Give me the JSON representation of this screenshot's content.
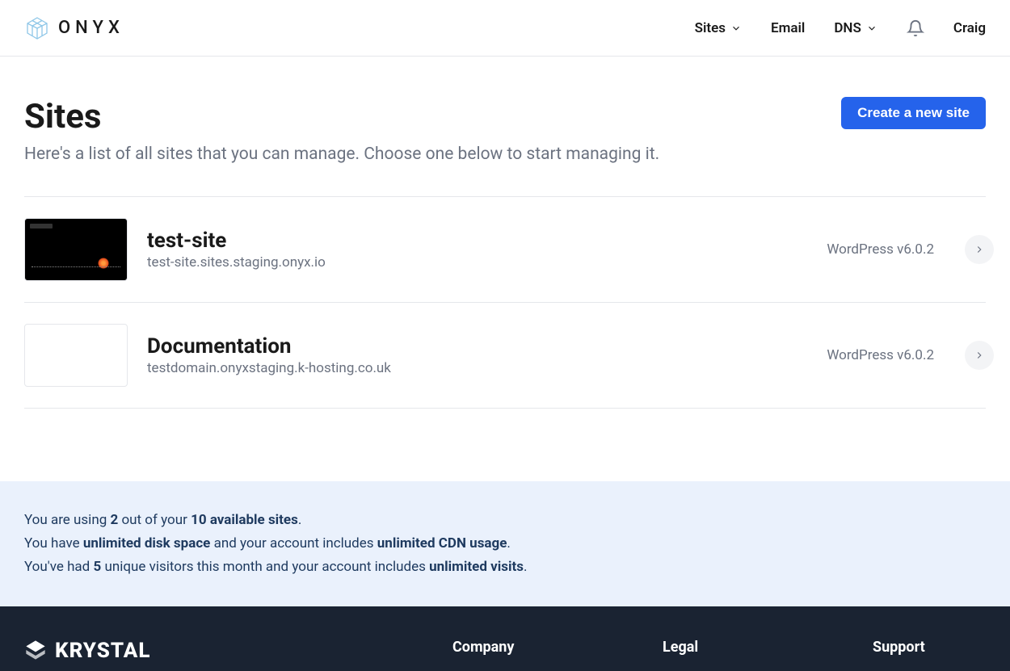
{
  "header": {
    "brand": "ONYX",
    "nav": {
      "sites": "Sites",
      "email": "Email",
      "dns": "DNS",
      "user": "Craig"
    }
  },
  "page": {
    "title": "Sites",
    "subtitle": "Here's a list of all sites that you can manage. Choose one below to start managing it.",
    "create_button": "Create a new site"
  },
  "sites": [
    {
      "name": "test-site",
      "domain": "test-site.sites.staging.onyx.io",
      "meta": "WordPress v6.0.2",
      "thumb": "dark"
    },
    {
      "name": "Documentation",
      "domain": "testdomain.onyxstaging.k-hosting.co.uk",
      "meta": "WordPress v6.0.2",
      "thumb": "light"
    }
  ],
  "usage": {
    "line1_pre": "You are using ",
    "line1_used": "2",
    "line1_mid": " out of your ",
    "line1_total": "10 available sites",
    "line1_post": ".",
    "line2_pre": "You have ",
    "line2_b1": "unlimited disk space",
    "line2_mid": " and your account includes ",
    "line2_b2": "unlimited CDN usage",
    "line2_post": ".",
    "line3_pre": "You've had ",
    "line3_b1": "5",
    "line3_mid": " unique visitors this month and your account includes ",
    "line3_b2": "unlimited visits",
    "line3_post": "."
  },
  "footer": {
    "brand": "KRYSTAL",
    "cols": {
      "company": "Company",
      "legal": "Legal",
      "support": "Support"
    }
  }
}
